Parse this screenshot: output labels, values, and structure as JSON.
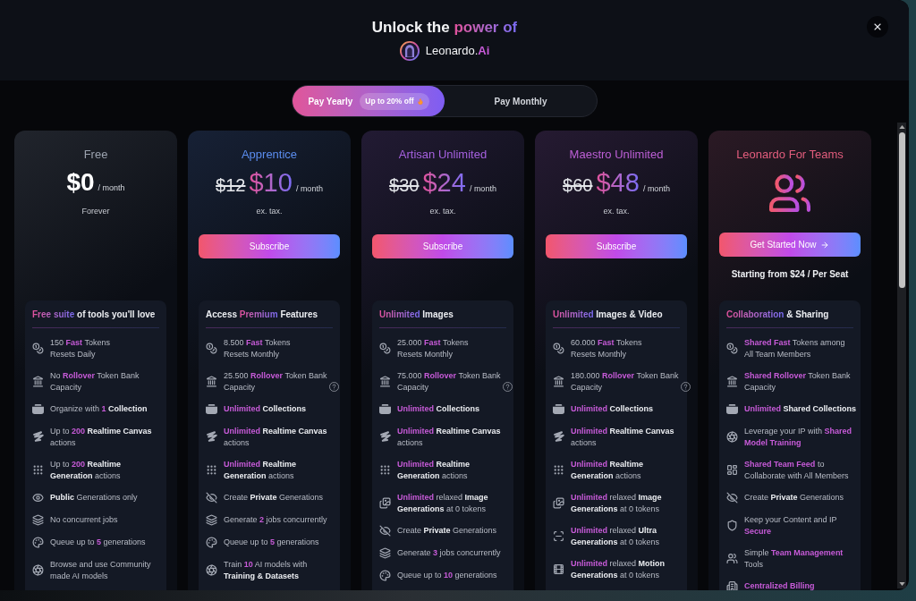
{
  "header": {
    "title": [
      {
        "text": "Unlock the ",
        "kind": "plain"
      },
      {
        "text": "power of",
        "kind": "gradient"
      }
    ],
    "brand": [
      {
        "text": "Leonardo.",
        "kind": "plain"
      },
      {
        "text": "Ai",
        "kind": "accent"
      }
    ]
  },
  "toggle": {
    "options": [
      {
        "label": "Pay Yearly",
        "selected": true,
        "badge": "Up to 20% off"
      },
      {
        "label": "Pay Monthly",
        "selected": false
      }
    ]
  },
  "plans": [
    {
      "name": "Free",
      "kind": "individual",
      "color": "#9ca3af",
      "price": "$0",
      "period": "/ month",
      "note": "Forever",
      "features_heading": [
        {
          "text": "Free suite",
          "kind": "gradient"
        },
        {
          "text": " of tools you'll love",
          "kind": "bold"
        }
      ],
      "features": [
        {
          "kind": "tokens",
          "parts": [
            {
              "text": "150 ",
              "kind": "plain"
            },
            {
              "text": "Fast",
              "kind": "accent"
            },
            {
              "text": " Tokens\nResets Daily",
              "kind": "plain"
            }
          ]
        },
        {
          "kind": "bank",
          "parts": [
            {
              "text": "No ",
              "kind": "plain"
            },
            {
              "text": "Rollover",
              "kind": "accent"
            },
            {
              "text": " Token Bank\nCapacity",
              "kind": "plain"
            }
          ]
        },
        {
          "kind": "collections",
          "parts": [
            {
              "text": "Organize with ",
              "kind": "plain"
            },
            {
              "text": "1",
              "kind": "accent"
            },
            {
              "text": " Collection",
              "kind": "bold"
            }
          ]
        },
        {
          "kind": "canvas",
          "parts": [
            {
              "text": "Up to ",
              "kind": "plain"
            },
            {
              "text": "200",
              "kind": "accent"
            },
            {
              "text": " Realtime Canvas",
              "kind": "bold"
            },
            {
              "text": "\nactions",
              "kind": "plain"
            }
          ]
        },
        {
          "kind": "realtime",
          "parts": [
            {
              "text": "Up to ",
              "kind": "plain"
            },
            {
              "text": "200",
              "kind": "accent"
            },
            {
              "text": " Realtime\nGeneration",
              "kind": "bold"
            },
            {
              "text": " actions",
              "kind": "plain"
            }
          ]
        },
        {
          "kind": "public",
          "parts": [
            {
              "text": "Public",
              "kind": "bold"
            },
            {
              "text": " Generations only",
              "kind": "plain"
            }
          ]
        },
        {
          "kind": "jobs",
          "parts": [
            {
              "text": "No concurrent jobs",
              "kind": "plain"
            }
          ]
        },
        {
          "kind": "queue",
          "parts": [
            {
              "text": "Queue up to ",
              "kind": "plain"
            },
            {
              "text": "5",
              "kind": "accent"
            },
            {
              "text": " generations",
              "kind": "plain"
            }
          ]
        },
        {
          "kind": "training",
          "parts": [
            {
              "text": "Browse and use Community\nmade AI models",
              "kind": "plain"
            }
          ]
        }
      ]
    },
    {
      "name": "Apprentice",
      "kind": "individual",
      "color": "#5b8def",
      "old_price": "$12",
      "price": "$10",
      "period": "/ month",
      "note": "ex. tax.",
      "button": {
        "label": "Subscribe"
      },
      "features_heading": [
        {
          "text": "Access ",
          "kind": "bold"
        },
        {
          "text": "Premium",
          "kind": "gradient"
        },
        {
          "text": " Features",
          "kind": "bold"
        }
      ],
      "features": [
        {
          "kind": "tokens",
          "parts": [
            {
              "text": "8.500 ",
              "kind": "plain"
            },
            {
              "text": "Fast",
              "kind": "accent"
            },
            {
              "text": " Tokens\nResets Monthly",
              "kind": "plain"
            }
          ]
        },
        {
          "kind": "bank",
          "help": true,
          "parts": [
            {
              "text": "25.500 ",
              "kind": "plain"
            },
            {
              "text": "Rollover",
              "kind": "accent"
            },
            {
              "text": " Token Bank\nCapacity",
              "kind": "plain"
            }
          ]
        },
        {
          "kind": "collections",
          "parts": [
            {
              "text": "Unlimited",
              "kind": "accent"
            },
            {
              "text": " Collections",
              "kind": "bold"
            }
          ]
        },
        {
          "kind": "canvas",
          "parts": [
            {
              "text": "Unlimited",
              "kind": "accent"
            },
            {
              "text": " Realtime Canvas",
              "kind": "bold"
            },
            {
              "text": "\nactions",
              "kind": "plain"
            }
          ]
        },
        {
          "kind": "realtime",
          "parts": [
            {
              "text": "Unlimited",
              "kind": "accent"
            },
            {
              "text": " Realtime\nGeneration",
              "kind": "bold"
            },
            {
              "text": " actions",
              "kind": "plain"
            }
          ]
        },
        {
          "kind": "private",
          "parts": [
            {
              "text": "Create ",
              "kind": "plain"
            },
            {
              "text": "Private",
              "kind": "bold"
            },
            {
              "text": " Generations",
              "kind": "plain"
            }
          ]
        },
        {
          "kind": "jobs",
          "parts": [
            {
              "text": "Generate ",
              "kind": "plain"
            },
            {
              "text": "2",
              "kind": "accent"
            },
            {
              "text": " jobs concurrently",
              "kind": "plain"
            }
          ]
        },
        {
          "kind": "queue",
          "parts": [
            {
              "text": "Queue up to ",
              "kind": "plain"
            },
            {
              "text": "5",
              "kind": "accent"
            },
            {
              "text": " generations",
              "kind": "plain"
            }
          ]
        },
        {
          "kind": "training",
          "parts": [
            {
              "text": "Train ",
              "kind": "plain"
            },
            {
              "text": "10",
              "kind": "accent"
            },
            {
              "text": " AI models with\n",
              "kind": "plain"
            },
            {
              "text": "Training & Datasets",
              "kind": "bold"
            }
          ]
        }
      ]
    },
    {
      "name": "Artisan Unlimited",
      "kind": "individual",
      "color": "#a661e0",
      "old_price": "$30",
      "price": "$24",
      "period": "/ month",
      "note": "ex. tax.",
      "button": {
        "label": "Subscribe"
      },
      "features_heading": [
        {
          "text": "Unlimited",
          "kind": "gradient"
        },
        {
          "text": " Images",
          "kind": "bold"
        }
      ],
      "features": [
        {
          "kind": "tokens",
          "parts": [
            {
              "text": "25.000 ",
              "kind": "plain"
            },
            {
              "text": "Fast",
              "kind": "accent"
            },
            {
              "text": " Tokens\nResets Monthly",
              "kind": "plain"
            }
          ]
        },
        {
          "kind": "bank",
          "help": true,
          "parts": [
            {
              "text": "75.000 ",
              "kind": "plain"
            },
            {
              "text": "Rollover",
              "kind": "accent"
            },
            {
              "text": " Token Bank\nCapacity",
              "kind": "plain"
            }
          ]
        },
        {
          "kind": "collections",
          "parts": [
            {
              "text": "Unlimited",
              "kind": "accent"
            },
            {
              "text": " Collections",
              "kind": "bold"
            }
          ]
        },
        {
          "kind": "canvas",
          "parts": [
            {
              "text": "Unlimited",
              "kind": "accent"
            },
            {
              "text": " Realtime Canvas",
              "kind": "bold"
            },
            {
              "text": "\nactions",
              "kind": "plain"
            }
          ]
        },
        {
          "kind": "realtime",
          "parts": [
            {
              "text": "Unlimited",
              "kind": "accent"
            },
            {
              "text": " Realtime\nGeneration",
              "kind": "bold"
            },
            {
              "text": " actions",
              "kind": "plain"
            }
          ]
        },
        {
          "kind": "images",
          "parts": [
            {
              "text": "Unlimited",
              "kind": "accent"
            },
            {
              "text": " relaxed ",
              "kind": "plain"
            },
            {
              "text": "Image\nGenerations",
              "kind": "bold"
            },
            {
              "text": " at 0 tokens",
              "kind": "plain"
            }
          ]
        },
        {
          "kind": "private",
          "parts": [
            {
              "text": "Create ",
              "kind": "plain"
            },
            {
              "text": "Private",
              "kind": "bold"
            },
            {
              "text": " Generations",
              "kind": "plain"
            }
          ]
        },
        {
          "kind": "jobs",
          "parts": [
            {
              "text": "Generate ",
              "kind": "plain"
            },
            {
              "text": "3",
              "kind": "accent"
            },
            {
              "text": " jobs concurrently",
              "kind": "plain"
            }
          ]
        },
        {
          "kind": "queue",
          "parts": [
            {
              "text": "Queue up to ",
              "kind": "plain"
            },
            {
              "text": "10",
              "kind": "accent"
            },
            {
              "text": " generations",
              "kind": "plain"
            }
          ]
        }
      ]
    },
    {
      "name": "Maestro Unlimited",
      "kind": "individual",
      "color": "#bd5fd6",
      "old_price": "$60",
      "price": "$48",
      "period": "/ month",
      "note": "ex. tax.",
      "button": {
        "label": "Subscribe"
      },
      "features_heading": [
        {
          "text": "Unlimited",
          "kind": "gradient"
        },
        {
          "text": " Images & Video",
          "kind": "bold"
        }
      ],
      "features": [
        {
          "kind": "tokens",
          "parts": [
            {
              "text": "60.000 ",
              "kind": "plain"
            },
            {
              "text": "Fast",
              "kind": "accent"
            },
            {
              "text": " Tokens\nResets Monthly",
              "kind": "plain"
            }
          ]
        },
        {
          "kind": "bank",
          "help": true,
          "parts": [
            {
              "text": "180.000 ",
              "kind": "plain"
            },
            {
              "text": "Rollover",
              "kind": "accent"
            },
            {
              "text": " Token Bank\nCapacity",
              "kind": "plain"
            }
          ]
        },
        {
          "kind": "collections",
          "parts": [
            {
              "text": "Unlimited",
              "kind": "accent"
            },
            {
              "text": " Collections",
              "kind": "bold"
            }
          ]
        },
        {
          "kind": "canvas",
          "parts": [
            {
              "text": "Unlimited",
              "kind": "accent"
            },
            {
              "text": " Realtime Canvas",
              "kind": "bold"
            },
            {
              "text": "\nactions",
              "kind": "plain"
            }
          ]
        },
        {
          "kind": "realtime",
          "parts": [
            {
              "text": "Unlimited",
              "kind": "accent"
            },
            {
              "text": " Realtime\nGeneration",
              "kind": "bold"
            },
            {
              "text": " actions",
              "kind": "plain"
            }
          ]
        },
        {
          "kind": "images",
          "parts": [
            {
              "text": "Unlimited",
              "kind": "accent"
            },
            {
              "text": " relaxed ",
              "kind": "plain"
            },
            {
              "text": "Image\nGenerations",
              "kind": "bold"
            },
            {
              "text": " at 0 tokens",
              "kind": "plain"
            }
          ]
        },
        {
          "kind": "ultra",
          "parts": [
            {
              "text": "Unlimited",
              "kind": "accent"
            },
            {
              "text": " relaxed ",
              "kind": "plain"
            },
            {
              "text": "Ultra\nGenerations",
              "kind": "bold"
            },
            {
              "text": " at 0 tokens",
              "kind": "plain"
            }
          ]
        },
        {
          "kind": "motion",
          "parts": [
            {
              "text": "Unlimited",
              "kind": "accent"
            },
            {
              "text": " relaxed ",
              "kind": "plain"
            },
            {
              "text": "Motion\nGenerations",
              "kind": "bold"
            },
            {
              "text": " at 0 tokens",
              "kind": "plain"
            }
          ]
        }
      ]
    },
    {
      "name": "Leonardo For Teams",
      "kind": "team",
      "color": "#e35d7d",
      "button": {
        "label": "Get Started Now",
        "arrow": true
      },
      "note": "Starting from $24 / Per Seat",
      "features_heading": [
        {
          "text": "Collaboration",
          "kind": "gradient"
        },
        {
          "text": " & Sharing",
          "kind": "bold"
        }
      ],
      "features": [
        {
          "kind": "tokens",
          "parts": [
            {
              "text": "Shared Fast",
              "kind": "accent"
            },
            {
              "text": " Tokens among\nAll Team Members",
              "kind": "plain"
            }
          ]
        },
        {
          "kind": "bank",
          "parts": [
            {
              "text": "Shared Rollover",
              "kind": "accent"
            },
            {
              "text": " Token Bank\nCapacity",
              "kind": "plain"
            }
          ]
        },
        {
          "kind": "collections",
          "parts": [
            {
              "text": "Unlimited",
              "kind": "accent"
            },
            {
              "text": " Shared Collections",
              "kind": "bold"
            }
          ]
        },
        {
          "kind": "training",
          "parts": [
            {
              "text": "Leverage your IP with ",
              "kind": "plain"
            },
            {
              "text": "Shared\nModel Training",
              "kind": "accent"
            }
          ]
        },
        {
          "kind": "feed",
          "parts": [
            {
              "text": "Shared Team Feed",
              "kind": "accent"
            },
            {
              "text": " to\nCollaborate with All Members",
              "kind": "plain"
            }
          ]
        },
        {
          "kind": "private",
          "parts": [
            {
              "text": "Create ",
              "kind": "plain"
            },
            {
              "text": "Private",
              "kind": "bold"
            },
            {
              "text": " Generations",
              "kind": "plain"
            }
          ]
        },
        {
          "kind": "secure",
          "parts": [
            {
              "text": "Keep your Content and IP\n",
              "kind": "plain"
            },
            {
              "text": "Secure",
              "kind": "accent"
            }
          ]
        },
        {
          "kind": "team",
          "parts": [
            {
              "text": "Simple ",
              "kind": "plain"
            },
            {
              "text": "Team Management",
              "kind": "accent"
            },
            {
              "text": "\nTools",
              "kind": "plain"
            }
          ]
        },
        {
          "kind": "billing",
          "parts": [
            {
              "text": "Centralized Billing",
              "kind": "accent"
            }
          ]
        }
      ]
    }
  ]
}
